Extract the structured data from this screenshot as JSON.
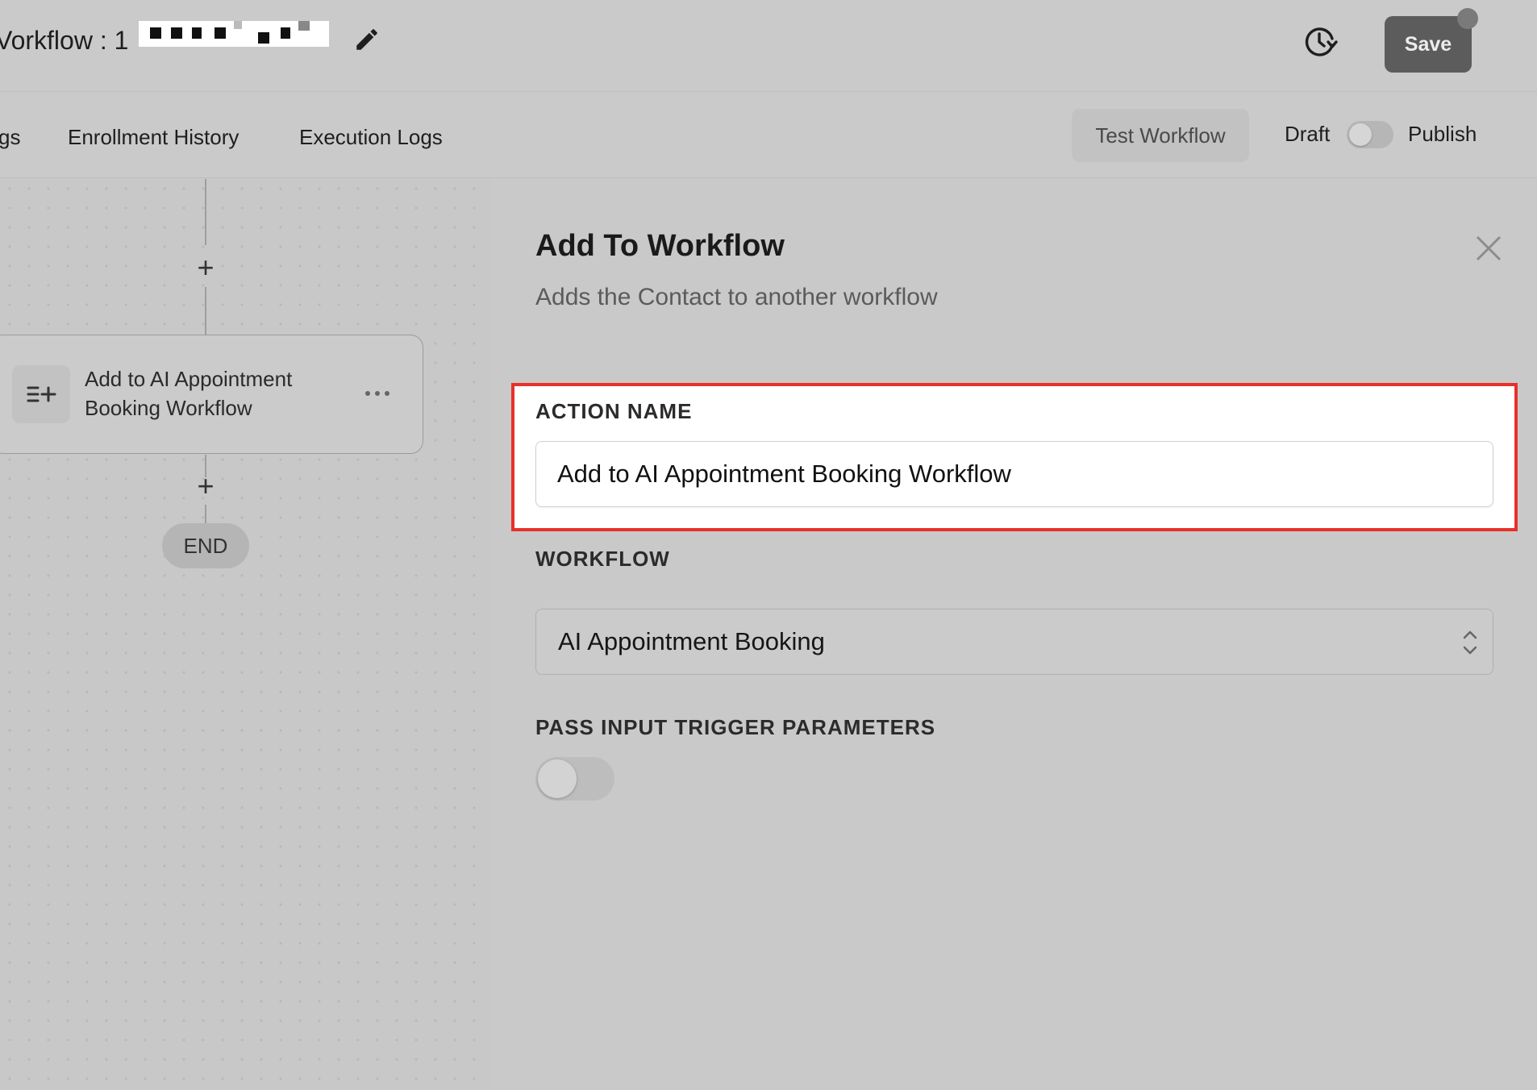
{
  "header": {
    "title_prefix": "Vorkflow : 1",
    "edit_icon": "pencil-icon",
    "history_icon": "history-icon",
    "save_label": "Save"
  },
  "tabs": [
    {
      "label": "gs"
    },
    {
      "label": "Enrollment History"
    },
    {
      "label": "Execution Logs"
    }
  ],
  "toolbar": {
    "test_label": "Test Workflow",
    "draft_label": "Draft",
    "publish_label": "Publish",
    "published": false
  },
  "canvas": {
    "node_label": "Add to AI Appointment Booking Workflow",
    "node_icon": "list-add-icon",
    "end_label": "END"
  },
  "panel": {
    "title": "Add To Workflow",
    "description": "Adds the Contact to another workflow",
    "action_name_label": "ACTION NAME",
    "action_name_value": "Add to AI Appointment Booking Workflow",
    "workflow_label": "WORKFLOW",
    "workflow_value": "AI Appointment Booking",
    "pass_params_label": "PASS INPUT TRIGGER PARAMETERS",
    "pass_params_enabled": false
  },
  "colors": {
    "highlight_border": "#e8302a",
    "save_button": "#5c5c5c",
    "background": "#c9c9c9"
  }
}
